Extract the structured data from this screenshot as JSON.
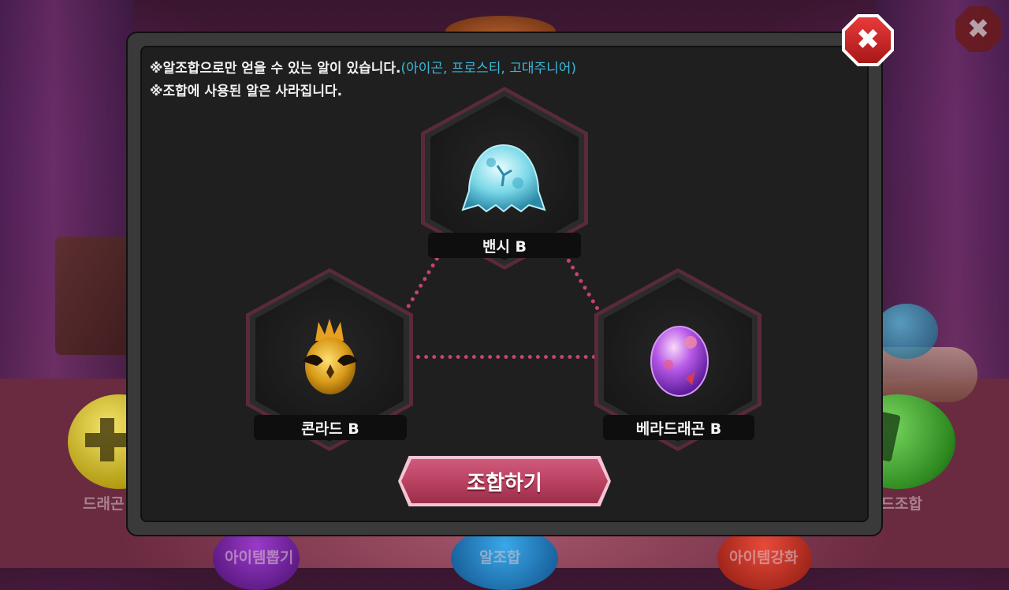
{
  "notices": {
    "line1": "※알조합으로만 얻을 수 있는 알이 있습니다.",
    "line1_highlight": "(아이곤, 프로스티, 고대주니어)",
    "line2": "※조합에 사용된 알은 사라집니다."
  },
  "eggs": {
    "top": {
      "name": "밴시 B",
      "icon": "banshee-egg-icon"
    },
    "left": {
      "name": "콘라드 B",
      "icon": "conrad-egg-icon"
    },
    "right": {
      "name": "베라드래곤 B",
      "icon": "vera-dragon-egg-icon"
    }
  },
  "combine_button": {
    "label": "조합하기"
  },
  "close_button": {
    "label": "✖",
    "icon": "close-icon"
  },
  "background_menu": {
    "left": "드래곤",
    "right": "카드조합",
    "bottom_left": "아이템뽑기",
    "bottom_center": "알조합",
    "bottom_right": "아이템강화",
    "close_label": "✖"
  },
  "colors": {
    "highlight": "#3cb8d8",
    "button": "#c04a6a",
    "close": "#d42828",
    "link_dots": "#c8426a"
  }
}
